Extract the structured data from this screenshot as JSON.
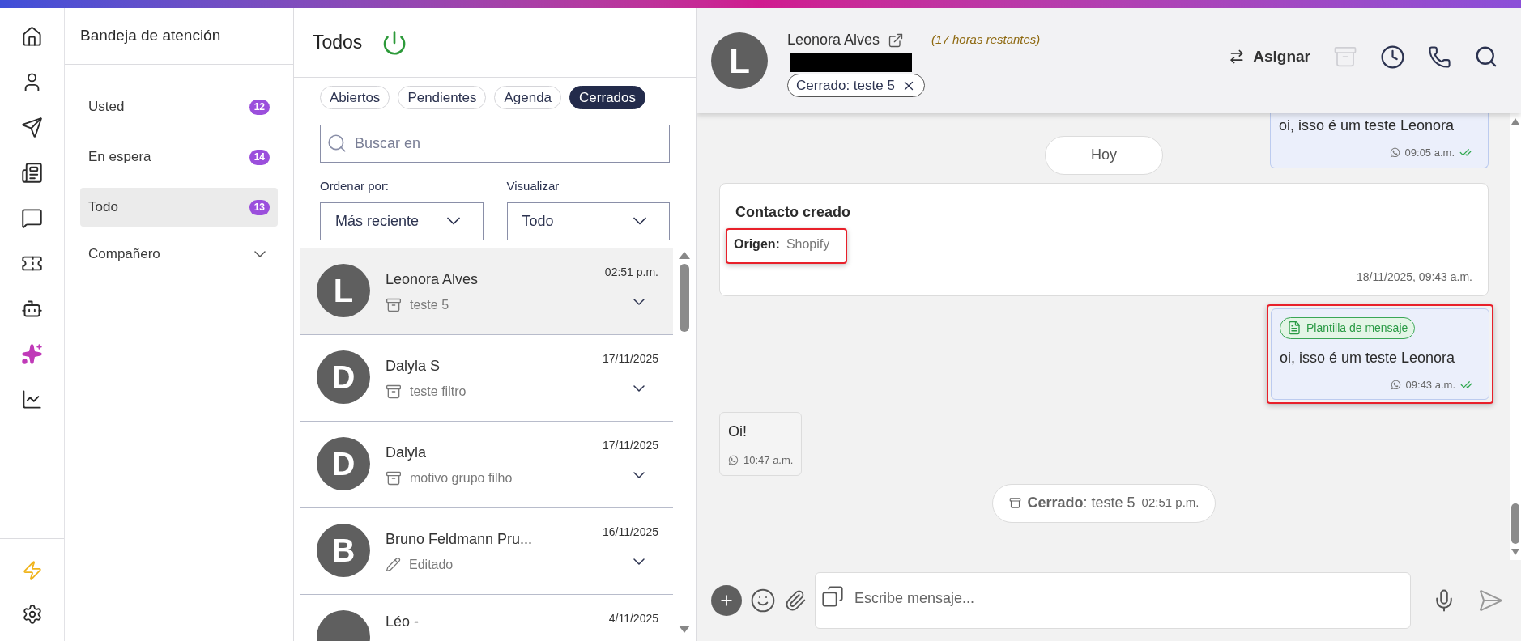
{
  "inbox": {
    "title": "Bandeja de atención",
    "items": [
      {
        "kind": "counter",
        "label": "Usted",
        "count": "12",
        "selected": false
      },
      {
        "kind": "counter",
        "label": "En espera",
        "count": "14",
        "selected": false
      },
      {
        "kind": "counter",
        "label": "Todo",
        "count": "13",
        "selected": true
      },
      {
        "kind": "group",
        "label": "Compañero",
        "expanded": false
      }
    ]
  },
  "list": {
    "title": "Todos",
    "on": true,
    "filters": [
      {
        "label": "Abiertos",
        "selected": false
      },
      {
        "label": "Pendientes",
        "selected": false
      },
      {
        "label": "Agenda",
        "selected": false
      },
      {
        "label": "Cerrados",
        "selected": true
      }
    ],
    "search": {
      "placeholder": "Buscar en"
    },
    "sort": {
      "label": "Ordenar por:",
      "value": "Más reciente"
    },
    "view": {
      "label": "Visualizar",
      "value": "Todo"
    },
    "conversations": [
      {
        "initial": "L",
        "name": "Leonora Alves",
        "kind": "archived",
        "preview": "teste 5",
        "time": "02:51 p.m.",
        "selected": true
      },
      {
        "initial": "D",
        "name": "Dalyla S",
        "kind": "archived",
        "preview": "teste filtro",
        "time": "17/11/2025",
        "selected": false
      },
      {
        "initial": "D",
        "name": "Dalyla",
        "kind": "archived",
        "preview": "motivo grupo filho",
        "time": "17/11/2025",
        "selected": false
      },
      {
        "initial": "B",
        "name": "Bruno Feldmann Pru...",
        "kind": "edited",
        "preview": "Editado",
        "time": "16/11/2025",
        "selected": false
      },
      {
        "name": "Léo -",
        "kind": "partial",
        "time": "4/11/2025",
        "selected": false
      }
    ]
  },
  "chat": {
    "header": {
      "initial": "L",
      "name": "Leonora Alves",
      "remaining": "(17 horas restantes)",
      "tag": "Cerrado: teste 5",
      "assign": "Asignar"
    },
    "messages": [
      {
        "kind": "outgoing",
        "text": "oi, isso é um teste Leonora",
        "time": "09:05 a.m.",
        "read": true,
        "highlighted": false
      },
      {
        "kind": "date",
        "text": "Hoy"
      },
      {
        "kind": "event",
        "title": "Contacto creado",
        "field_label": "Origen:",
        "field_value": "Shopify",
        "time": "18/11/2025, 09:43 a.m.",
        "highlighted": true
      },
      {
        "kind": "outgoing",
        "template": "Plantilla de mensaje",
        "text": "oi, isso é um teste Leonora",
        "time": "09:43 a.m.",
        "read": true,
        "highlighted": true
      },
      {
        "kind": "incoming",
        "text": "Oi!",
        "time": "10:47 a.m."
      },
      {
        "kind": "status",
        "text": "**Cerrado**: teste 5",
        "time": "02:51 p.m."
      }
    ],
    "composer": {
      "placeholder": "Escribe mensaje..."
    }
  }
}
